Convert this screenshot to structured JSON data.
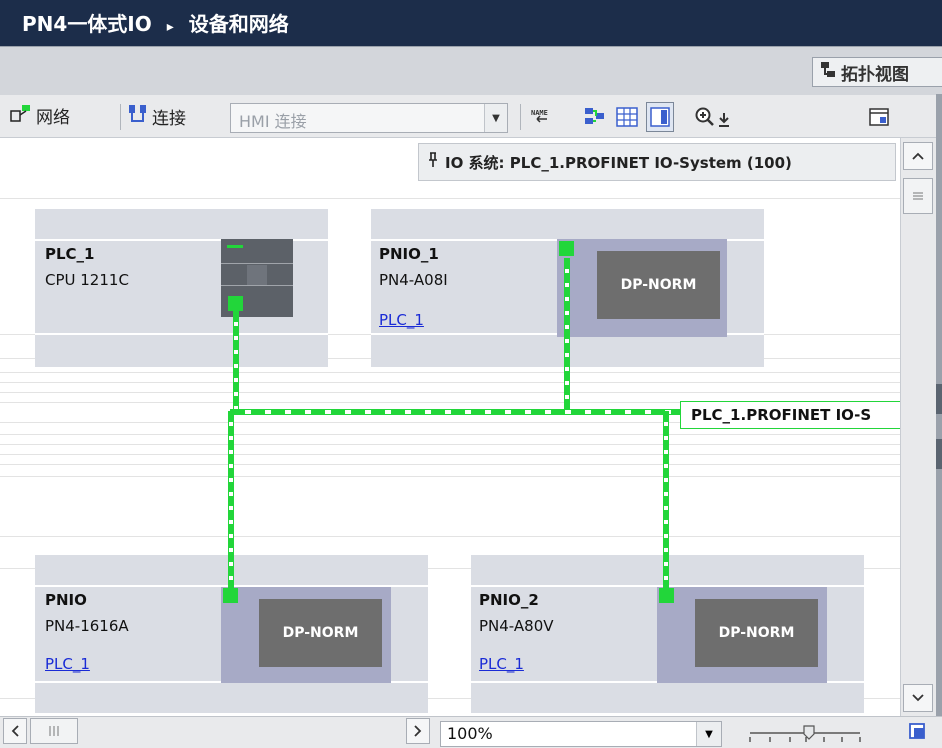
{
  "breadcrumb": {
    "project": "PN4一体式IO",
    "separator": "▸",
    "page": "设备和网络"
  },
  "view_tabs": {
    "topology": "拓扑视图"
  },
  "toolbar": {
    "network_label": "网络",
    "connections_label": "连接",
    "connection_type": "HMI 连接"
  },
  "io_system": {
    "pin_icon": "pin-icon",
    "label": "IO 系统: PLC_1.PROFINET IO-System (100)"
  },
  "devices": [
    {
      "name": "PLC_1",
      "type": "CPU 1211C"
    },
    {
      "name": "PNIO_1",
      "type": "PN4-A08I",
      "master": "PLC_1",
      "module_label": "DP-NORM"
    },
    {
      "name": "PNIO",
      "type": "PN4-1616A",
      "master": "PLC_1",
      "module_label": "DP-NORM"
    },
    {
      "name": "PNIO_2",
      "type": "PN4-A80V",
      "master": "PLC_1",
      "module_label": "DP-NORM"
    }
  ],
  "network": {
    "label": "PLC_1.PROFINET IO-S",
    "color": "#22d63a"
  },
  "statusbar": {
    "zoom": "100%"
  },
  "colors": {
    "titlebar": "#1c2d4a",
    "device_bg": "#dadde4",
    "io_body": "#a7aac6",
    "module": "#6e6e6e",
    "link": "#1a2bd6"
  }
}
